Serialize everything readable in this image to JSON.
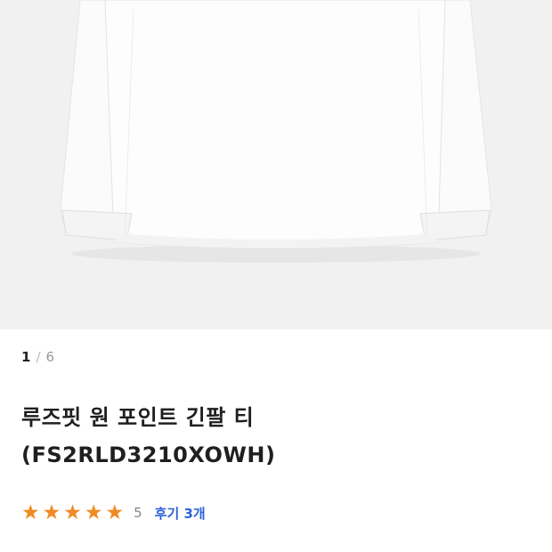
{
  "gallery": {
    "current": "1",
    "separator": "/",
    "total": "6"
  },
  "product": {
    "name_line1": "루즈핏 원 포인트 긴팔 티",
    "name_line2": "(FS2RLD3210XOWH)"
  },
  "rating": {
    "stars_filled": 5,
    "stars_total": 5,
    "score": "5",
    "reviews_link": "후기 3개",
    "star_color": "#f08a24"
  },
  "colors": {
    "photo_background": "#f1f1f1",
    "link": "#2b63d9"
  }
}
